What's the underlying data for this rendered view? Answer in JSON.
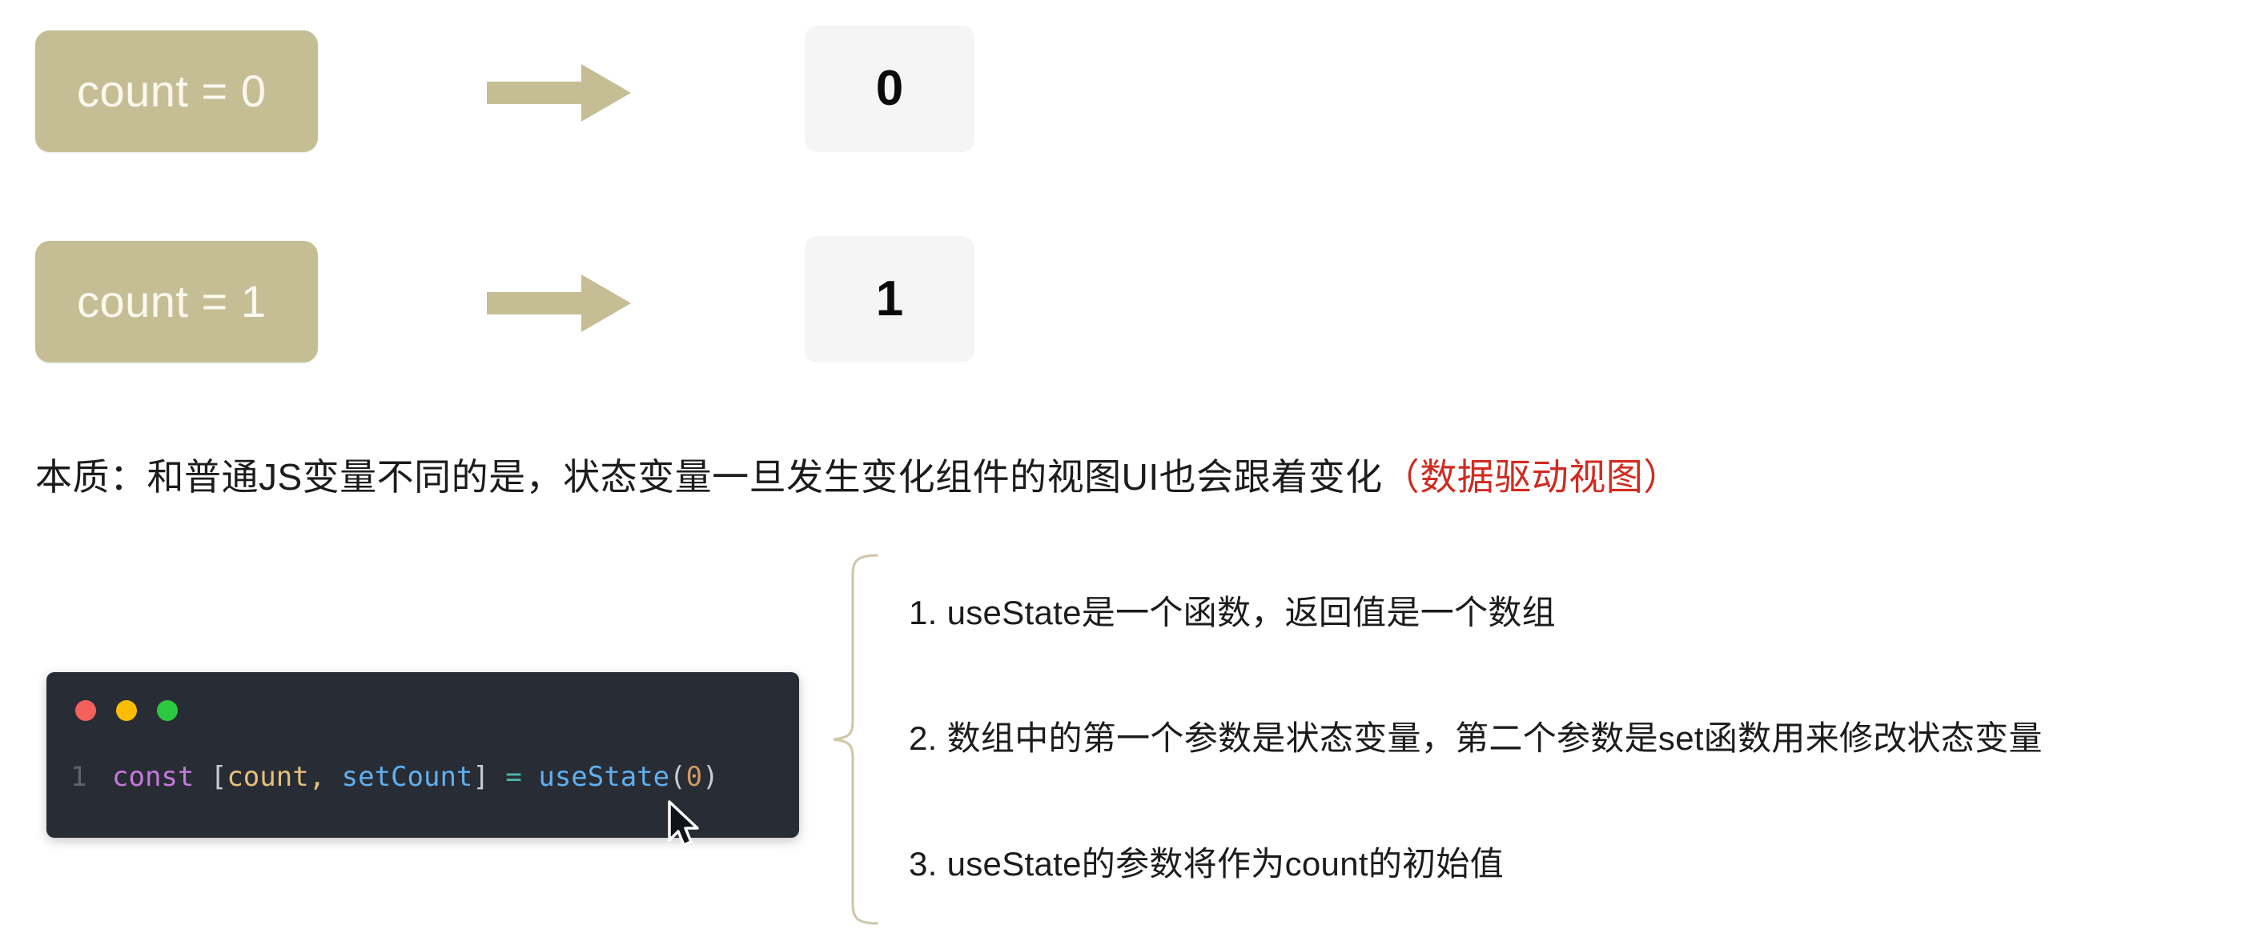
{
  "state_rows": [
    {
      "pill_label": "count = 0",
      "arrow_icon": "right-block-arrow-icon",
      "value": "0"
    },
    {
      "pill_label": "count = 1",
      "arrow_icon": "right-block-arrow-icon",
      "value": "1"
    }
  ],
  "essence": {
    "plain": "本质：和普通JS变量不同的是，状态变量一旦发生变化组件的视图UI也会跟着变化",
    "accent": "（数据驱动视图）"
  },
  "code_card": {
    "traffic_lights": [
      "close-dot-red",
      "minimize-dot-yellow",
      "maximize-dot-green"
    ],
    "line_number": "1",
    "tokens": [
      {
        "text": "const",
        "type": "keyword"
      },
      {
        "text": " ",
        "type": "plain"
      },
      {
        "text": "[",
        "type": "punct"
      },
      {
        "text": "count",
        "type": "variable"
      },
      {
        "text": ", ",
        "type": "variable"
      },
      {
        "text": "setCount",
        "type": "function"
      },
      {
        "text": "]",
        "type": "punct"
      },
      {
        "text": " ",
        "type": "plain"
      },
      {
        "text": "=",
        "type": "operator"
      },
      {
        "text": " ",
        "type": "plain"
      },
      {
        "text": "useState",
        "type": "function"
      },
      {
        "text": "(",
        "type": "punct"
      },
      {
        "text": "0",
        "type": "number"
      },
      {
        "text": ")",
        "type": "punct"
      }
    ],
    "full_code": "const [count, setCount] = useState(0)"
  },
  "brace_icon": "left-curly-brace-icon",
  "notes": [
    "1. useState是一个函数，返回值是一个数组",
    "2. 数组中的第一个参数是状态变量，第二个参数是set函数用来修改状态变量",
    "3. useState的参数将作为count的初始值"
  ],
  "cursor_icon": "mouse-pointer-icon",
  "colors": {
    "tan": "#c5be95",
    "pill_text": "#fbf8ee",
    "chip_bg": "#f5f5f6",
    "accent_red": "#d02b20",
    "code_bg": "#282c34",
    "keyword": "#c678dd",
    "variable": "#e5c07b",
    "function": "#61afef",
    "operator": "#4db6ac",
    "number": "#d19a66",
    "punct": "#c8ccd4",
    "line_number": "#5c6370"
  }
}
